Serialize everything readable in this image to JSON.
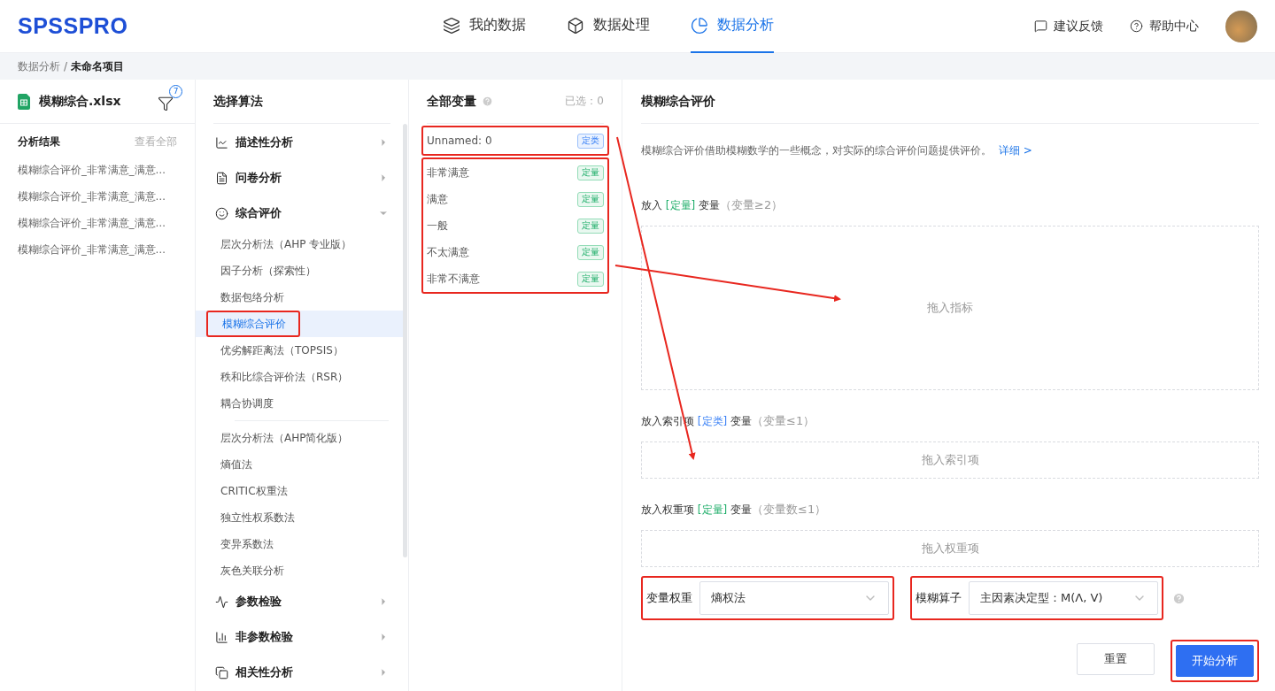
{
  "header": {
    "logo": "SPSSPRO",
    "nav": [
      {
        "label": "我的数据",
        "selected": false
      },
      {
        "label": "数据处理",
        "selected": false
      },
      {
        "label": "数据分析",
        "selected": true
      }
    ],
    "actions": [
      {
        "label": "建议反馈"
      },
      {
        "label": "帮助中心"
      }
    ]
  },
  "breadcrumb": {
    "separator": "/",
    "items": [
      {
        "label": "数据分析",
        "current": false
      },
      {
        "label": "未命名项目",
        "current": true
      }
    ]
  },
  "file_panel": {
    "file_name": "模糊综合.xlsx",
    "filter_count": "7",
    "results_title": "分析结果",
    "view_all": "查看全部",
    "results": [
      "模糊综合评价_非常满意_满意…",
      "模糊综合评价_非常满意_满意…",
      "模糊综合评价_非常满意_满意…",
      "模糊综合评价_非常满意_满意…"
    ]
  },
  "algorithm_panel": {
    "title": "选择算法",
    "groups": [
      {
        "label": "描述性分析",
        "expanded": false
      },
      {
        "label": "问卷分析",
        "expanded": false
      },
      {
        "label": "综合评价",
        "expanded": true,
        "sections": [
          [
            {
              "label": "层次分析法（AHP 专业版）",
              "selected": false,
              "highlighted": false
            },
            {
              "label": "因子分析（探索性）",
              "selected": false,
              "highlighted": false
            },
            {
              "label": "数据包络分析",
              "selected": false,
              "highlighted": false
            },
            {
              "label": "模糊综合评价",
              "selected": true,
              "highlighted": true
            },
            {
              "label": "优劣解距离法（TOPSIS）",
              "selected": false,
              "highlighted": false
            },
            {
              "label": "秩和比综合评价法（RSR）",
              "selected": false,
              "highlighted": false
            },
            {
              "label": "耦合协调度",
              "selected": false,
              "highlighted": false
            }
          ],
          [
            {
              "label": "层次分析法（AHP简化版）",
              "selected": false,
              "highlighted": false
            },
            {
              "label": "熵值法",
              "selected": false,
              "highlighted": false
            },
            {
              "label": "CRITIC权重法",
              "selected": false,
              "highlighted": false
            },
            {
              "label": "独立性权系数法",
              "selected": false,
              "highlighted": false
            },
            {
              "label": "变异系数法",
              "selected": false,
              "highlighted": false
            },
            {
              "label": "灰色关联分析",
              "selected": false,
              "highlighted": false
            }
          ]
        ]
      },
      {
        "label": "参数检验",
        "expanded": false
      },
      {
        "label": "非参数检验",
        "expanded": false
      },
      {
        "label": "相关性分析",
        "expanded": false
      }
    ]
  },
  "variables_panel": {
    "title": "全部变量",
    "selected_count": "已选：0",
    "groups": [
      {
        "highlighted": true,
        "items": [
          {
            "name": "Unnamed: 0",
            "kind": "categorical",
            "tag": "定类"
          }
        ]
      },
      {
        "highlighted": true,
        "items": [
          {
            "name": "非常满意",
            "kind": "quantitative",
            "tag": "定量"
          },
          {
            "name": "满意",
            "kind": "quantitative",
            "tag": "定量"
          },
          {
            "name": "一般",
            "kind": "quantitative",
            "tag": "定量"
          },
          {
            "name": "不太满意",
            "kind": "quantitative",
            "tag": "定量"
          },
          {
            "name": "非常不满意",
            "kind": "quantitative",
            "tag": "定量"
          }
        ]
      }
    ]
  },
  "config_panel": {
    "title": "模糊综合评价",
    "description": "模糊综合评价借助模糊数学的一些概念，对实际的综合评价问题提供评价。",
    "detail_link": "详细 >",
    "drop_zones": [
      {
        "prefix": "放入",
        "tag": "[定量]",
        "kind": "quantitative",
        "suffix": "变量",
        "hint": "（变量≥2）",
        "placeholder": "拖入指标"
      },
      {
        "prefix": "放入索引项",
        "tag": "[定类]",
        "kind": "categorical",
        "suffix": "变量",
        "hint": "（变量≤1）",
        "placeholder": "拖入索引项"
      },
      {
        "prefix": "放入权重项",
        "tag": "[定量]",
        "kind": "quantitative",
        "suffix": "变量",
        "hint": "（变量数≤1）",
        "placeholder": "拖入权重项"
      }
    ],
    "selects": [
      {
        "label": "变量权重",
        "value": "熵权法",
        "highlighted": true,
        "help": false
      },
      {
        "label": "模糊算子",
        "value": "主因素决定型：M(Λ, V)",
        "highlighted": true,
        "help": true
      }
    ],
    "buttons": [
      {
        "label": "重置",
        "kind": "secondary",
        "highlighted": false
      },
      {
        "label": "开始分析",
        "kind": "primary",
        "highlighted": true
      }
    ]
  }
}
